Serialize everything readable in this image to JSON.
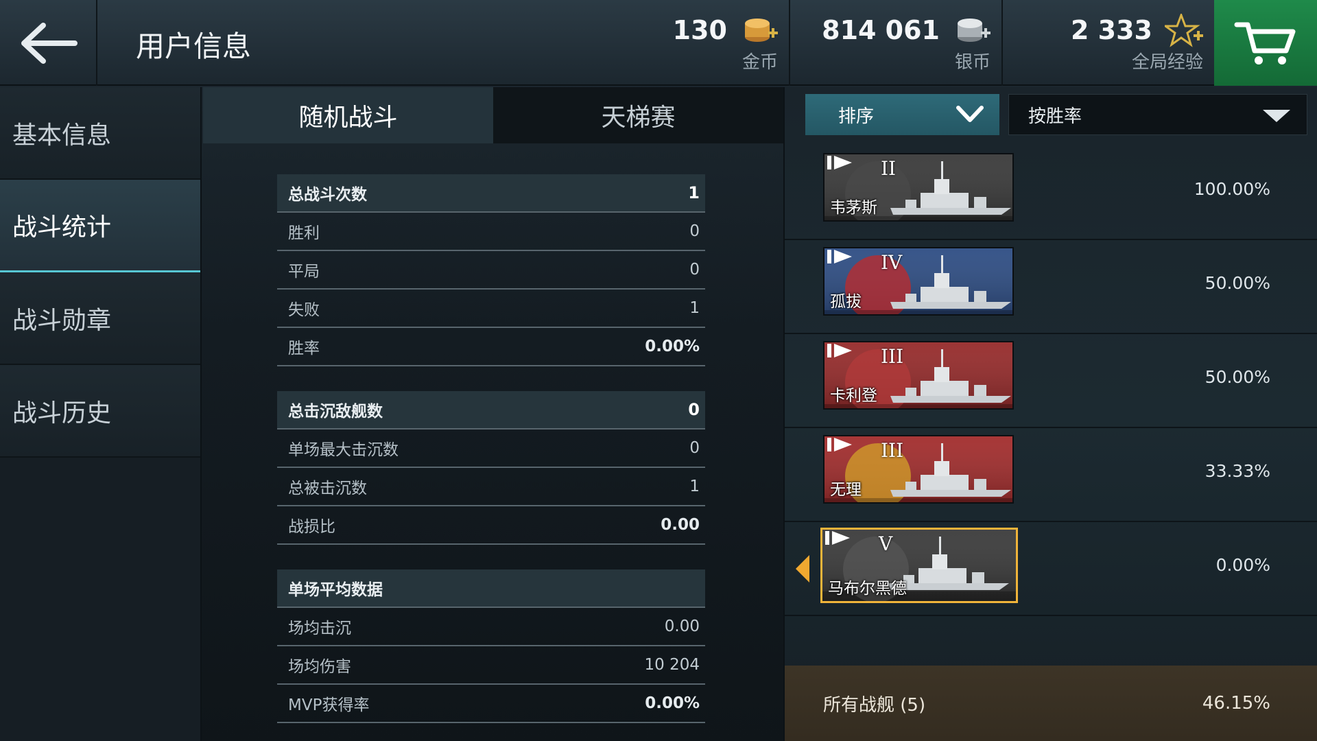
{
  "header": {
    "title": "用户信息",
    "gold": {
      "value": "130",
      "label": "金币"
    },
    "silver": {
      "value": "814 061",
      "label": "银币"
    },
    "xp": {
      "value": "2 333",
      "label": "全局经验"
    }
  },
  "nav": {
    "items": [
      {
        "label": "基本信息",
        "active": false
      },
      {
        "label": "战斗统计",
        "active": true
      },
      {
        "label": "战斗勋章",
        "active": false
      },
      {
        "label": "战斗历史",
        "active": false
      }
    ]
  },
  "tabs": [
    {
      "label": "随机战斗",
      "active": true
    },
    {
      "label": "天梯赛",
      "active": false
    }
  ],
  "stats": {
    "battles": {
      "label": "总战斗次数",
      "value": "1"
    },
    "wins": {
      "label": "胜利",
      "value": "0"
    },
    "draws": {
      "label": "平局",
      "value": "0"
    },
    "losses": {
      "label": "失败",
      "value": "1"
    },
    "winrate": {
      "label": "胜率",
      "value": "0.00%"
    },
    "kills": {
      "label": "总击沉敌舰数",
      "value": "0"
    },
    "max_kills": {
      "label": "单场最大击沉数",
      "value": "0"
    },
    "deaths": {
      "label": "总被击沉数",
      "value": "1"
    },
    "kd": {
      "label": "战损比",
      "value": "0.00"
    },
    "avg_head": {
      "label": "单场平均数据"
    },
    "avg_kills": {
      "label": "场均击沉",
      "value": "0.00"
    },
    "avg_damage": {
      "label": "场均伤害",
      "value": "10 204"
    },
    "mvp": {
      "label": "MVP获得率",
      "value": "0.00%"
    }
  },
  "sort": {
    "button_label": "排序",
    "selected": "按胜率"
  },
  "ships": [
    {
      "name": "韦茅斯",
      "tier": "II",
      "winrate": "100.00%",
      "bg": "#2a2a2a",
      "emblem": "#4a4a4a"
    },
    {
      "name": "孤拔",
      "tier": "IV",
      "winrate": "50.00%",
      "bg": "#1d3f7a",
      "emblem": "#c22a2a"
    },
    {
      "name": "卡利登",
      "tier": "III",
      "winrate": "50.00%",
      "bg": "#8e1a1a",
      "emblem": "#b33b3b"
    },
    {
      "name": "无理",
      "tier": "III",
      "winrate": "33.33%",
      "bg": "#9b1c1c",
      "emblem": "#d3a12a"
    },
    {
      "name": "马布尔黑德",
      "tier": "V",
      "winrate": "0.00%",
      "bg": "#2b2b2b",
      "emblem": "#555555",
      "selected": true
    }
  ],
  "summary": {
    "label": "所有战舰 (5)",
    "winrate": "46.15%"
  },
  "colors": {
    "accent": "#57c7d4",
    "cart": "#1f8a4a",
    "selected_border": "#f0b43a"
  }
}
